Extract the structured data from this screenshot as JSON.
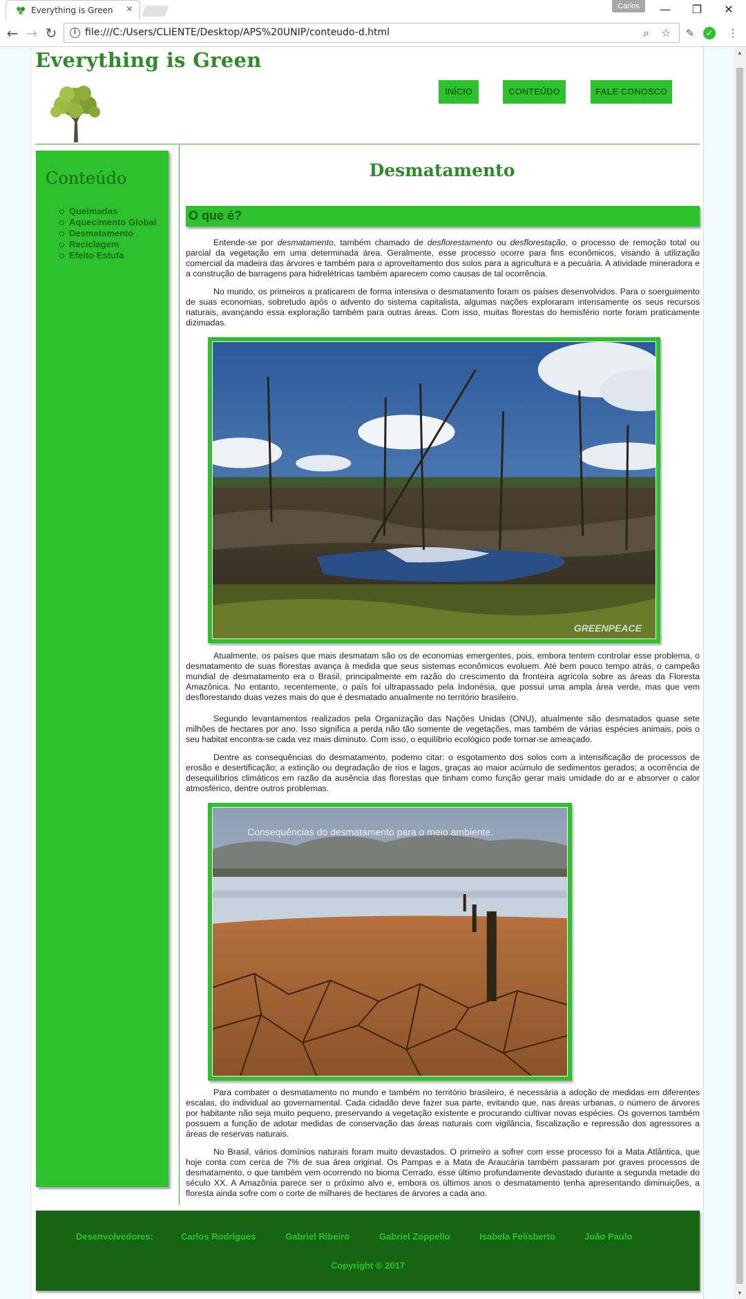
{
  "browser": {
    "tab_title": "Everything is Green",
    "profile_name": "Carlos",
    "url": "file:///C:/Users/CLIENTE/Desktop/APS%20UNIP/conteudo-d.html"
  },
  "site": {
    "brand": "Everything is Green",
    "nav": [
      "INÍCIO",
      "CONTEÚDO",
      "FALE CONOSCO"
    ]
  },
  "sidebar": {
    "title": "Conteúdo",
    "items": [
      "Queimadas",
      "Aquecimento Global",
      "Desmatamento",
      "Reciclagem",
      "Efeito Estufa"
    ]
  },
  "content": {
    "title": "Desmatamento",
    "section_title": "O que é?",
    "p1_a": "Entende-se por ",
    "p1_em1": "desmatamento",
    "p1_b": ", também chamado de ",
    "p1_em2": "desflorestamento",
    "p1_c": " ou ",
    "p1_em3": "desflorestação",
    "p1_d": ", o processo de remoção total ou parcial da vegetação em uma determinada área. Geralmente, esse processo ocorre para fins econômicos, visando à utilização comercial da madeira das árvores e também para o aproveitamento dos solos para a agricultura e a pecuária. A atividade mineradora e a construção de barragens para hidrelétricas também aparecem como causas de tal ocorrência.",
    "p2": "No mundo, os primeiros a praticarem de forma intensiva o desmatamento foram os países desenvolvidos. Para o soerguimento de suas economias, sobretudo após o advento do sistema capitalista, algumas nações exploraram intensamente os seus recursos naturais, avançando essa exploração também para outras áreas. Com isso, muitas florestas do hemisfério norte foram praticamente dizimadas.",
    "image1_watermark": "GREENPEACE",
    "p3": "Atualmente, os países que mais desmatam são os de economias emergentes, pois, embora tentem controlar esse problema, o desmatamento de suas florestas avança à medida que seus sistemas econômicos evoluem. Até bem pouco tempo atrás, o campeão mundial de desmatamento era o Brasil, principalmente em razão do crescimento da fronteira agrícola sobre as áreas da Floresta Amazônica. No entanto, recentemente, o país foi ultrapassado pela Indonésia, que possui uma ampla área verde, mas que vem desflorestando duas vezes mais do que é desmatado anualmente no território brasileiro.",
    "p4": "Segundo levantamentos realizados pela Organização das Nações Unidas (ONU), atualmente são desmatados quase sete milhões de hectares por ano. Isso significa a perda não tão somente de vegetações, mas também de várias espécies animais, pois o seu habitat encontra-se cada vez mais diminuto. Com isso, o equilíbrio ecológico pode tornar-se ameaçado.",
    "p5": "Dentre as consequências do desmatamento, podemo citar: o esgotamento dos solos com a intensificação de processos de erosão e desertificação; a extinção ou degradação de rios e lagos, graças ao maior acúmulo de sedimentos gerados; a ocorrência de desequilíbrios climáticos em razão da ausência das florestas que tinham como função gerar mais umidade do ar e absorver o calor atmosférico, dentre outros problemas.",
    "image2_caption": "Consequências do desmatamento para o meio ambiente.",
    "p6": "Para combater o desmatamento no mundo e também no território brasileiro, é necessária a adoção de medidas em diferentes escalas, do individual ao governamental. Cada cidadão deve fazer sua parte, evitando que, nas áreas urbanas, o número de árvores por habitante não seja muito pequeno, preservando a vegetação existente e procurando cultivar novas espécies. Os governos também possuem a função de adotar medidas de conservação das áreas naturais com vigilância, fiscalização e repressão dos agressores a áreas de reservas naturais.",
    "p7": "No Brasil, vários domínios naturais foram muito devastados. O primeiro a sofrer com esse processo foi a Mata Atlântica, que hoje conta com cerca de 7% de sua área original. Os Pampas e a Mata de Araucária também passaram por graves processos de desmatamento, o que também vem ocorrendo no bioma Cerrado, esse último profundamente devastado durante a segunda metade do século XX. A Amazônia parece ser o próximo alvo e, embora os últimos anos o desmatamento tenha apresentando diminuições, a floresta ainda sofre com o corte de milhares de hectares de árvores a cada ano."
  },
  "footer": {
    "label": "Desenvolvedores:",
    "developers": [
      "Carlos Rodrigues",
      "Gabriel Ribeiro",
      "Gabriel Zoppello",
      "Isabela Felisberto",
      "João Paulo"
    ],
    "copyright": "Copyright © 2017"
  },
  "colors": {
    "accent_green": "#2dc22d",
    "dark_green": "#156515",
    "title_green": "#2f8a2a"
  }
}
